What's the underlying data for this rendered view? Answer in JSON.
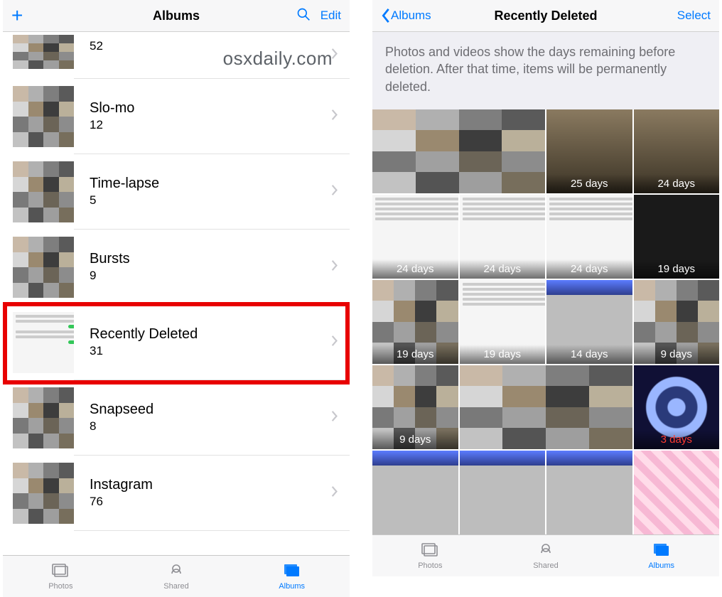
{
  "watermark": "osxdaily.com",
  "left": {
    "nav": {
      "title": "Albums",
      "edit": "Edit"
    },
    "albums": [
      {
        "name": "",
        "count": "52"
      },
      {
        "name": "Slo-mo",
        "count": "12"
      },
      {
        "name": "Time-lapse",
        "count": "5"
      },
      {
        "name": "Bursts",
        "count": "9"
      },
      {
        "name": "Recently Deleted",
        "count": "31"
      },
      {
        "name": "Snapseed",
        "count": "8"
      },
      {
        "name": "Instagram",
        "count": "76"
      }
    ],
    "highlighted_index": 4
  },
  "right": {
    "nav": {
      "back": "Albums",
      "title": "Recently Deleted",
      "select": "Select"
    },
    "info": "Photos and videos show the days remaining before deletion. After that time, items will be permanently deleted.",
    "grid": [
      {
        "span": 2,
        "label": "",
        "kind": "mosaic"
      },
      {
        "span": 1,
        "label": "25 days",
        "kind": "photo"
      },
      {
        "span": 1,
        "label": "24 days",
        "kind": "photo"
      },
      {
        "span": 1,
        "label": "24 days",
        "kind": "settings"
      },
      {
        "span": 1,
        "label": "24 days",
        "kind": "settings"
      },
      {
        "span": 1,
        "label": "24 days",
        "kind": "settings"
      },
      {
        "span": 1,
        "label": "19 days",
        "kind": "dark"
      },
      {
        "span": 1,
        "label": "19 days",
        "kind": "mosaic"
      },
      {
        "span": 1,
        "label": "19 days",
        "kind": "settings"
      },
      {
        "span": 1,
        "label": "14 days",
        "kind": "apps"
      },
      {
        "span": 1,
        "label": "9 days",
        "kind": "mosaic"
      },
      {
        "span": 1,
        "label": "9 days",
        "kind": "mosaic"
      },
      {
        "span": 2,
        "label": "",
        "kind": "mosaic"
      },
      {
        "span": 1,
        "label": "3 days",
        "kind": "spiral",
        "red": true
      },
      {
        "span": 1,
        "label": "",
        "kind": "apps"
      },
      {
        "span": 1,
        "label": "",
        "kind": "apps"
      },
      {
        "span": 1,
        "label": "",
        "kind": "apps"
      },
      {
        "span": 1,
        "label": "",
        "kind": "keyboard"
      }
    ]
  },
  "tabs": {
    "photos": "Photos",
    "shared": "Shared",
    "albums": "Albums"
  }
}
